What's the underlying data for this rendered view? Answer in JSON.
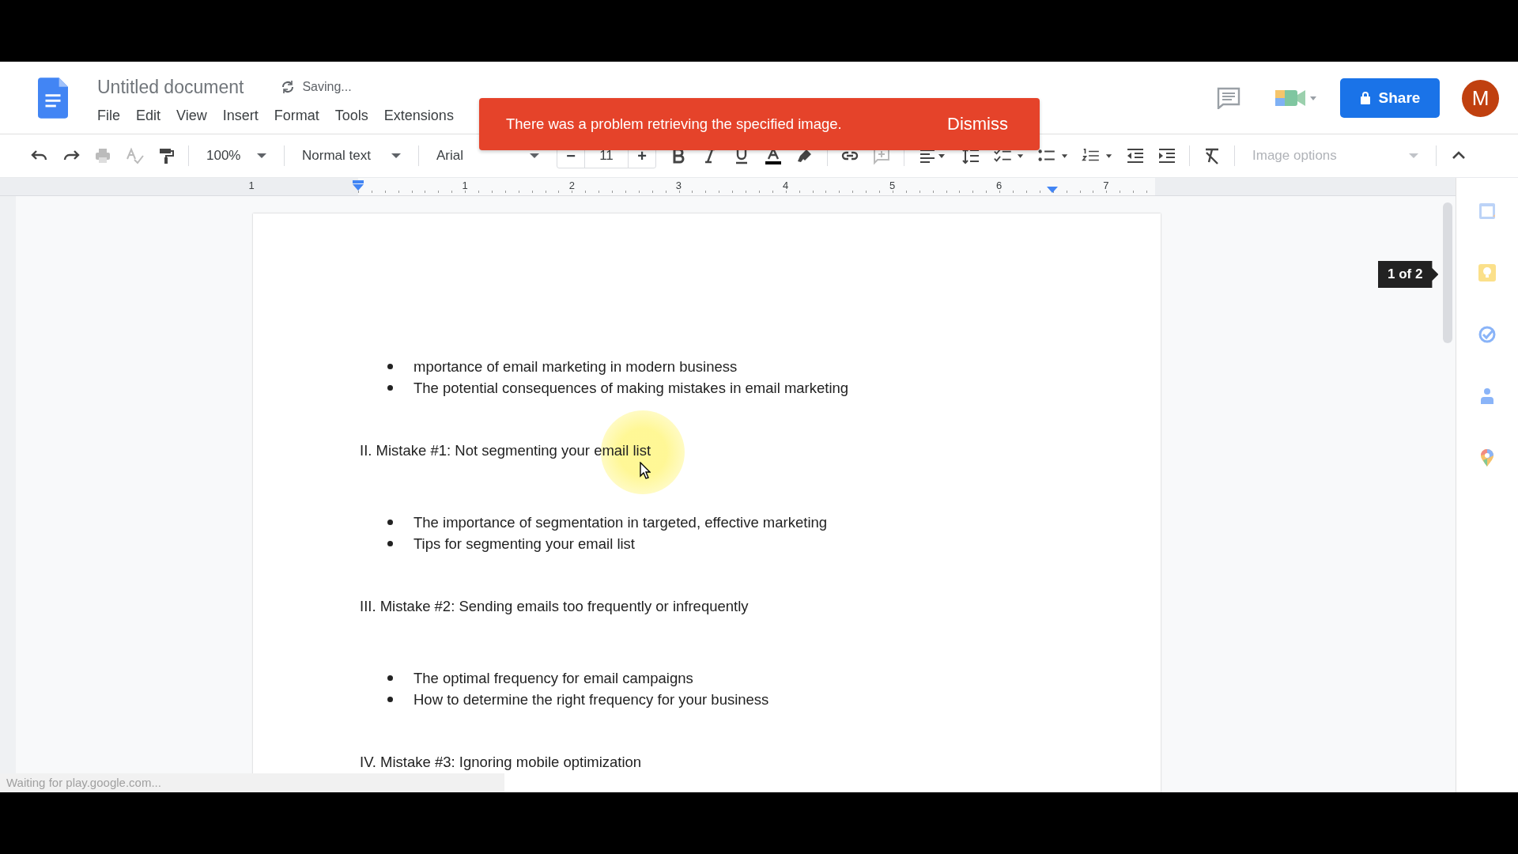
{
  "header": {
    "title": "Untitled document",
    "save_status": "Saving...",
    "menus": [
      "File",
      "Edit",
      "View",
      "Insert",
      "Format",
      "Tools",
      "Extensions"
    ],
    "share": "Share",
    "avatar": "M"
  },
  "toolbar": {
    "zoom": "100%",
    "style": "Normal text",
    "font": "Arial",
    "font_size": "11",
    "decrease": "−",
    "increase": "+",
    "image_options": "Image options"
  },
  "ruler": {
    "labels": [
      "1",
      "1",
      "2",
      "3",
      "4",
      "5",
      "6",
      "7"
    ]
  },
  "toast": {
    "message": "There was a problem retrieving the specified image.",
    "action": "Dismiss"
  },
  "document": {
    "blocks": [
      {
        "kind": "bullets",
        "items": [
          "mportance of email marketing in modern business",
          "The potential consequences of making mistakes in email marketing"
        ]
      },
      {
        "kind": "heading",
        "text": "II. Mistake #1: Not segmenting your email list"
      },
      {
        "kind": "bullets",
        "items": [
          "The importance of segmentation in targeted, effective marketing",
          "Tips for segmenting your email list"
        ]
      },
      {
        "kind": "heading",
        "text": "III. Mistake #2: Sending emails too frequently or infrequently"
      },
      {
        "kind": "bullets",
        "items": [
          "The optimal frequency for email campaigns",
          "How to determine the right frequency for your business"
        ]
      },
      {
        "kind": "heading",
        "text": "IV. Mistake #3: Ignoring mobile optimization"
      }
    ]
  },
  "page_indicator": "1 of 2",
  "status": "Waiting for play.google.com..."
}
